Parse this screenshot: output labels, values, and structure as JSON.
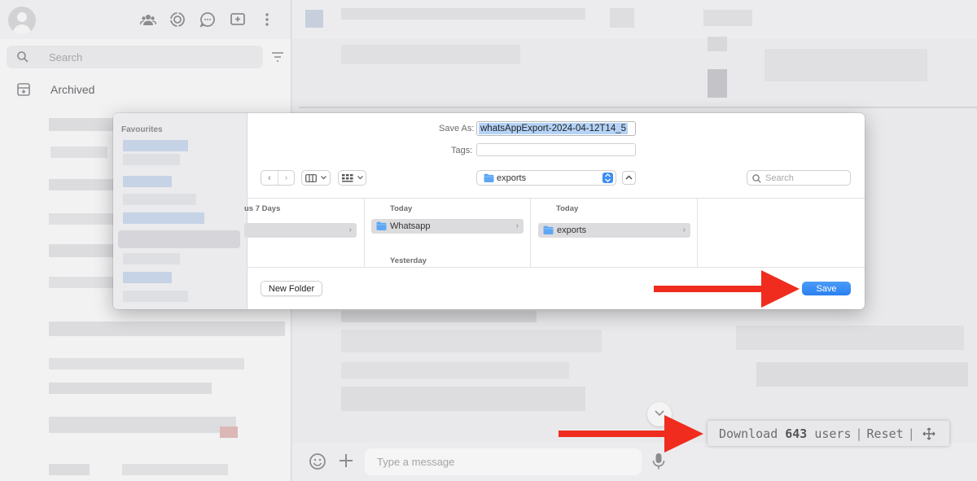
{
  "sidebar": {
    "search_placeholder": "Search",
    "archived_label": "Archived"
  },
  "chat": {
    "message_placeholder": "Type a message"
  },
  "download_toolbar": {
    "download_label": "Download",
    "user_count": "643",
    "users_label": "users",
    "separator": "|",
    "reset_label": "Reset"
  },
  "save_dialog": {
    "favourites_title": "Favourites",
    "save_as_label": "Save As:",
    "file_name": "whatsAppExport-2024-04-12T14_5",
    "tags_label": "Tags:",
    "location": "exports",
    "search_placeholder": "Search",
    "columns": [
      {
        "header": "us 7 Days"
      },
      {
        "header": "Today",
        "row_label": "Whatsapp",
        "subheader": "Yesterday"
      },
      {
        "header": "Today",
        "row_label": "exports"
      }
    ],
    "new_folder_label": "New Folder",
    "save_label": "Save"
  },
  "colors": {
    "accent_blue": "#2a80f0",
    "selection_blue": "#b4d3f7",
    "arrow_red": "#ef2c1e"
  }
}
